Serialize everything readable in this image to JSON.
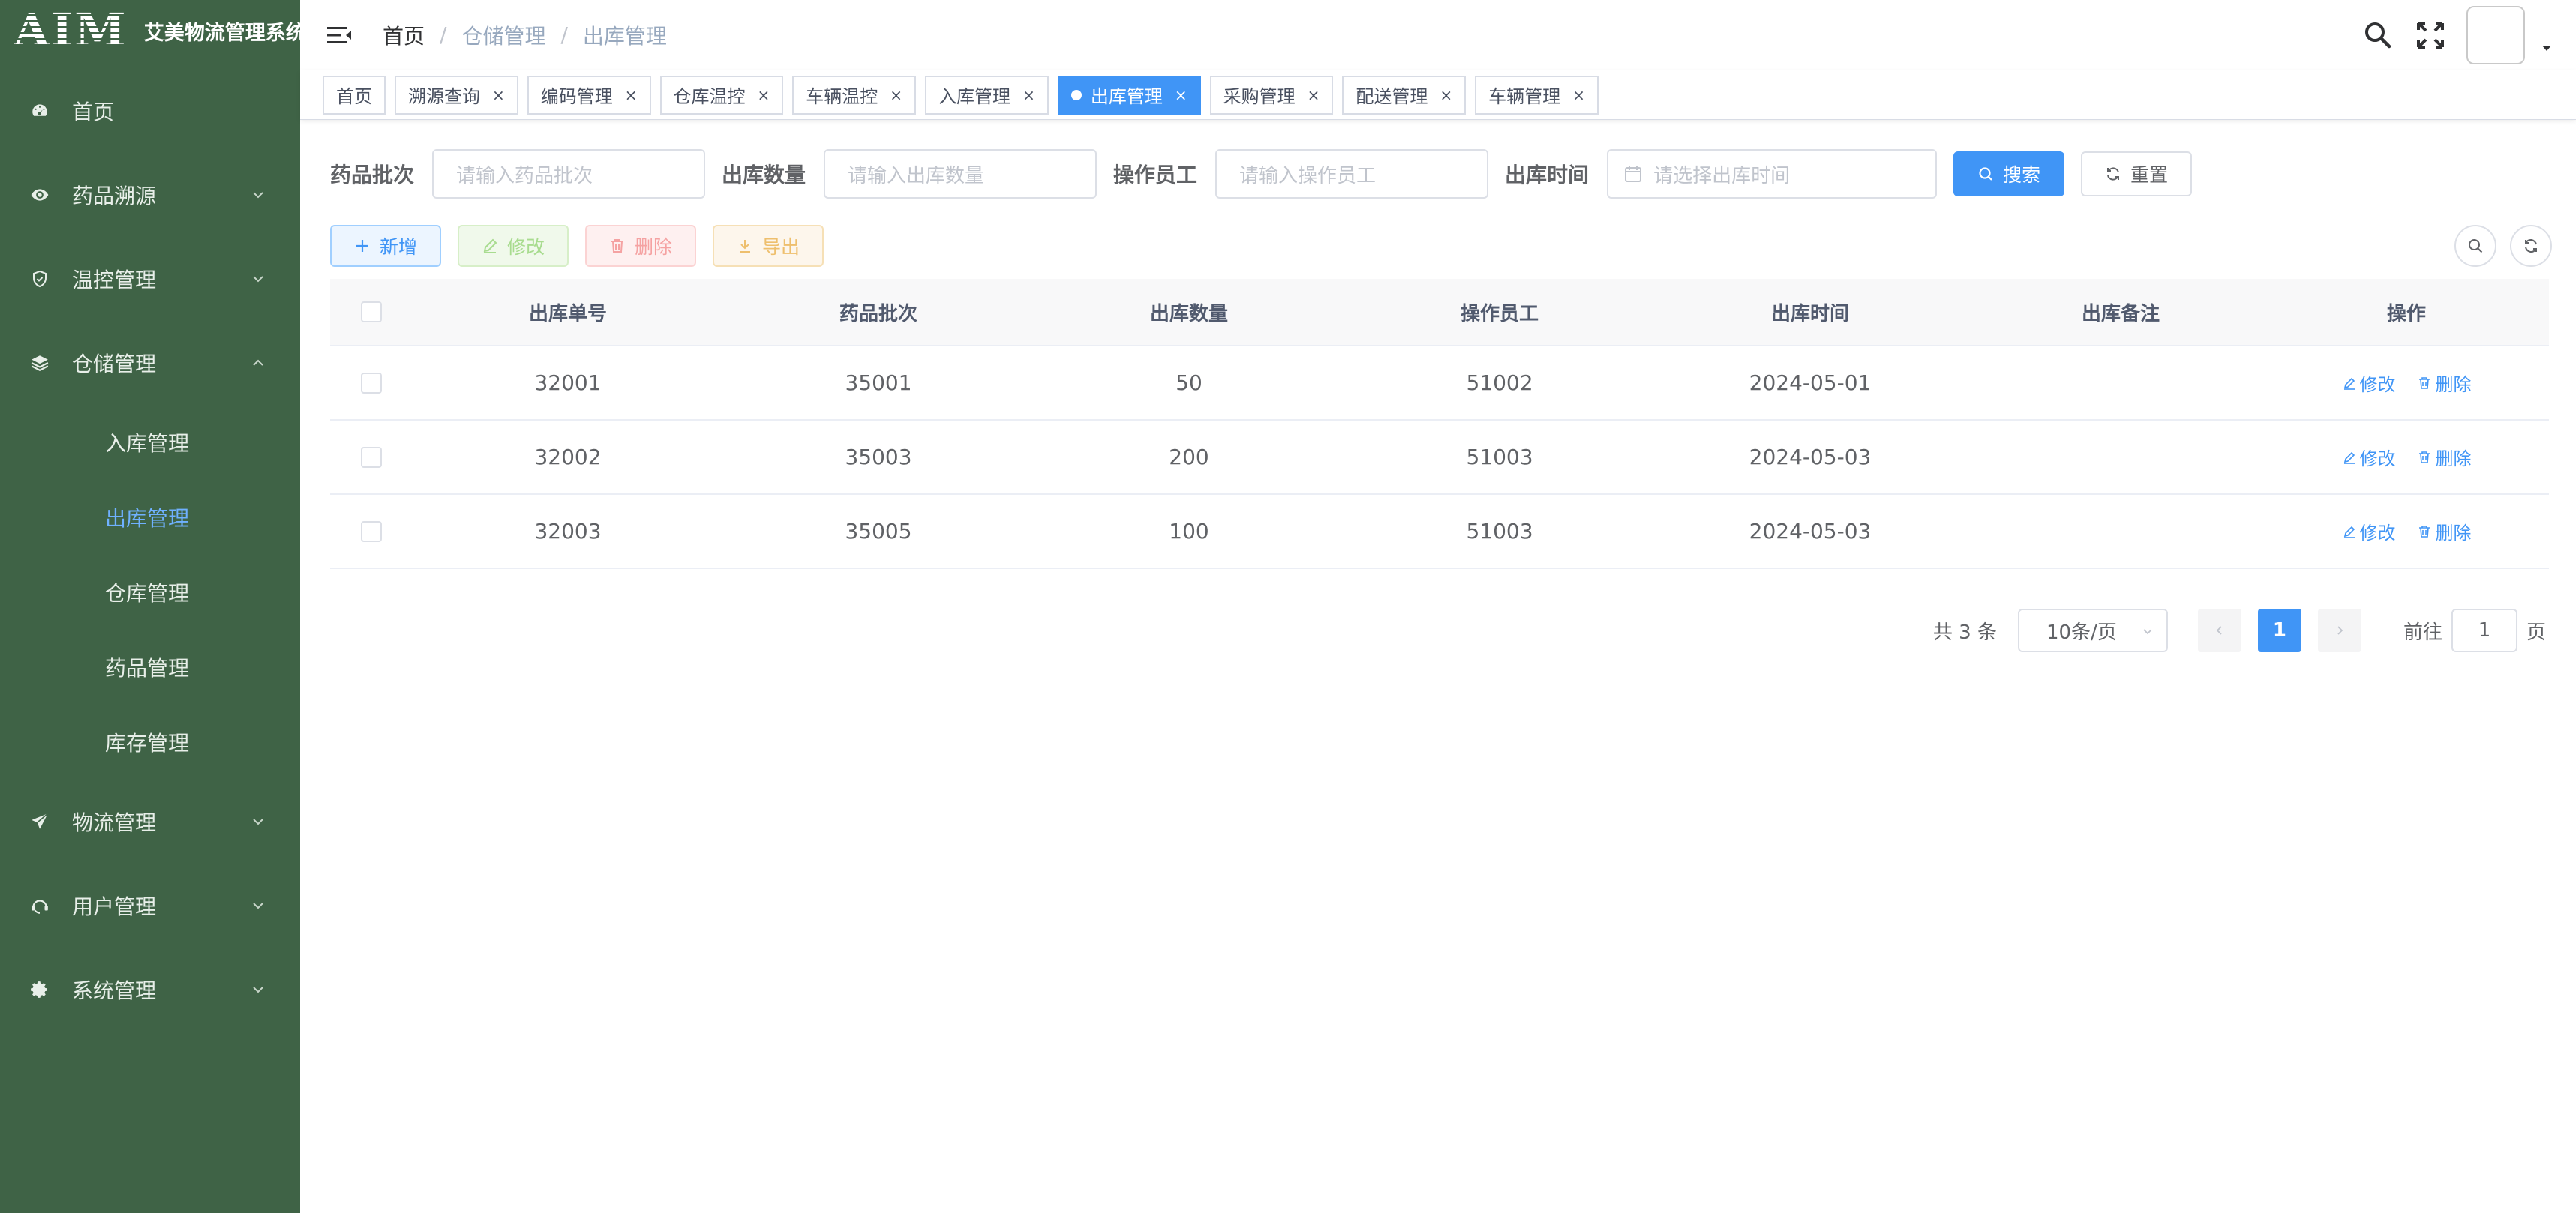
{
  "app": {
    "logo": "AIM",
    "title": "艾美物流管理系统"
  },
  "sidebar": {
    "items": [
      {
        "label": "首页",
        "icon": "dashboard-icon",
        "expandable": false
      },
      {
        "label": "药品溯源",
        "icon": "eye-icon",
        "expandable": true
      },
      {
        "label": "温控管理",
        "icon": "shield-icon",
        "expandable": true
      },
      {
        "label": "仓储管理",
        "icon": "layers-icon",
        "expandable": true,
        "expanded": true,
        "children": [
          {
            "label": "入库管理",
            "active": false
          },
          {
            "label": "出库管理",
            "active": true
          },
          {
            "label": "仓库管理",
            "active": false
          },
          {
            "label": "药品管理",
            "active": false
          },
          {
            "label": "库存管理",
            "active": false
          }
        ]
      },
      {
        "label": "物流管理",
        "icon": "send-icon",
        "expandable": true
      },
      {
        "label": "用户管理",
        "icon": "user-icon",
        "expandable": true
      },
      {
        "label": "系统管理",
        "icon": "gear-icon",
        "expandable": true
      }
    ]
  },
  "header": {
    "breadcrumb": [
      "首页",
      "仓储管理",
      "出库管理"
    ],
    "separator": "/"
  },
  "tags": [
    {
      "label": "首页",
      "closable": false,
      "active": false
    },
    {
      "label": "溯源查询",
      "closable": true,
      "active": false
    },
    {
      "label": "编码管理",
      "closable": true,
      "active": false
    },
    {
      "label": "仓库温控",
      "closable": true,
      "active": false
    },
    {
      "label": "车辆温控",
      "closable": true,
      "active": false
    },
    {
      "label": "入库管理",
      "closable": true,
      "active": false
    },
    {
      "label": "出库管理",
      "closable": true,
      "active": true
    },
    {
      "label": "采购管理",
      "closable": true,
      "active": false
    },
    {
      "label": "配送管理",
      "closable": true,
      "active": false
    },
    {
      "label": "车辆管理",
      "closable": true,
      "active": false
    }
  ],
  "tag_close": "×",
  "search": {
    "batch_label": "药品批次",
    "batch_placeholder": "请输入药品批次",
    "qty_label": "出库数量",
    "qty_placeholder": "请输入出库数量",
    "operator_label": "操作员工",
    "operator_placeholder": "请输入操作员工",
    "time_label": "出库时间",
    "time_placeholder": "请选择出库时间",
    "search_btn": "搜索",
    "reset_btn": "重置"
  },
  "toolbar": {
    "add": "新增",
    "edit": "修改",
    "delete": "删除",
    "export": "导出"
  },
  "table": {
    "columns": [
      "出库单号",
      "药品批次",
      "出库数量",
      "操作员工",
      "出库时间",
      "出库备注",
      "操作"
    ],
    "rows": [
      {
        "id": "32001",
        "batch": "35001",
        "qty": "50",
        "operator": "51002",
        "time": "2024-05-01",
        "note": ""
      },
      {
        "id": "32002",
        "batch": "35003",
        "qty": "200",
        "operator": "51003",
        "time": "2024-05-03",
        "note": ""
      },
      {
        "id": "32003",
        "batch": "35005",
        "qty": "100",
        "operator": "51003",
        "time": "2024-05-03",
        "note": ""
      }
    ],
    "op_edit": "修改",
    "op_delete": "删除"
  },
  "pagination": {
    "total": "共 3 条",
    "page_size": "10条/页",
    "current": "1",
    "goto_label": "前往",
    "goto_value": "1",
    "page_suffix": "页"
  },
  "colors": {
    "sidebar_bg": "#3f6346",
    "accent": "#4095f6",
    "active_sub": "#6fb1ff"
  }
}
